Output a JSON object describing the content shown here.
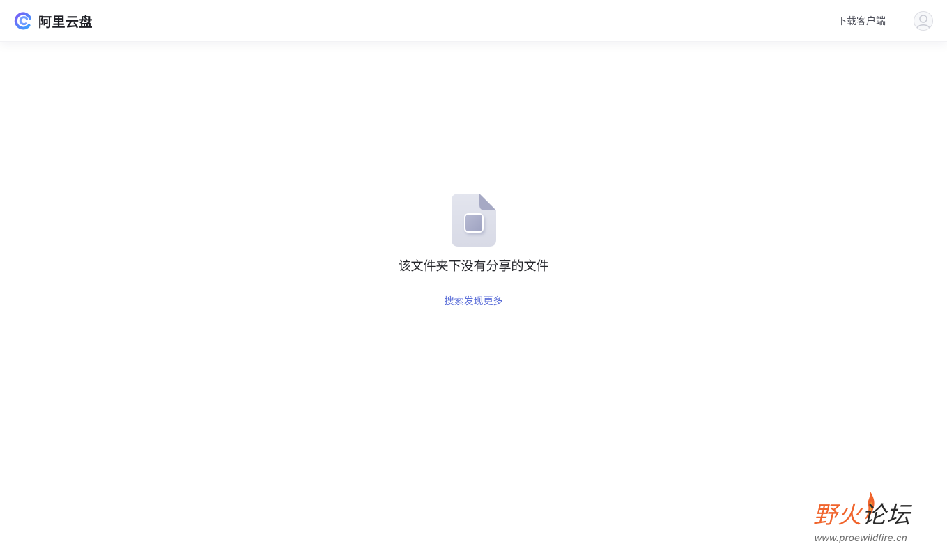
{
  "header": {
    "brand_name": "阿里云盘",
    "download_label": "下载客户端"
  },
  "main": {
    "empty_message": "该文件夹下没有分享的文件",
    "discover_link": "搜索发现更多"
  },
  "watermark": {
    "title_part1": "野火",
    "title_part2": "论坛",
    "url": "www.proewildfire.cn"
  },
  "colors": {
    "brand_gradient_start": "#6b5cf0",
    "brand_gradient_end": "#3ea0ff",
    "link": "#5b6ed8",
    "watermark_orange": "#f0642c"
  },
  "icons": {
    "logo": "aliyun-drive-logo-icon",
    "avatar": "user-avatar-icon",
    "empty": "empty-file-icon",
    "flame": "flame-icon"
  }
}
